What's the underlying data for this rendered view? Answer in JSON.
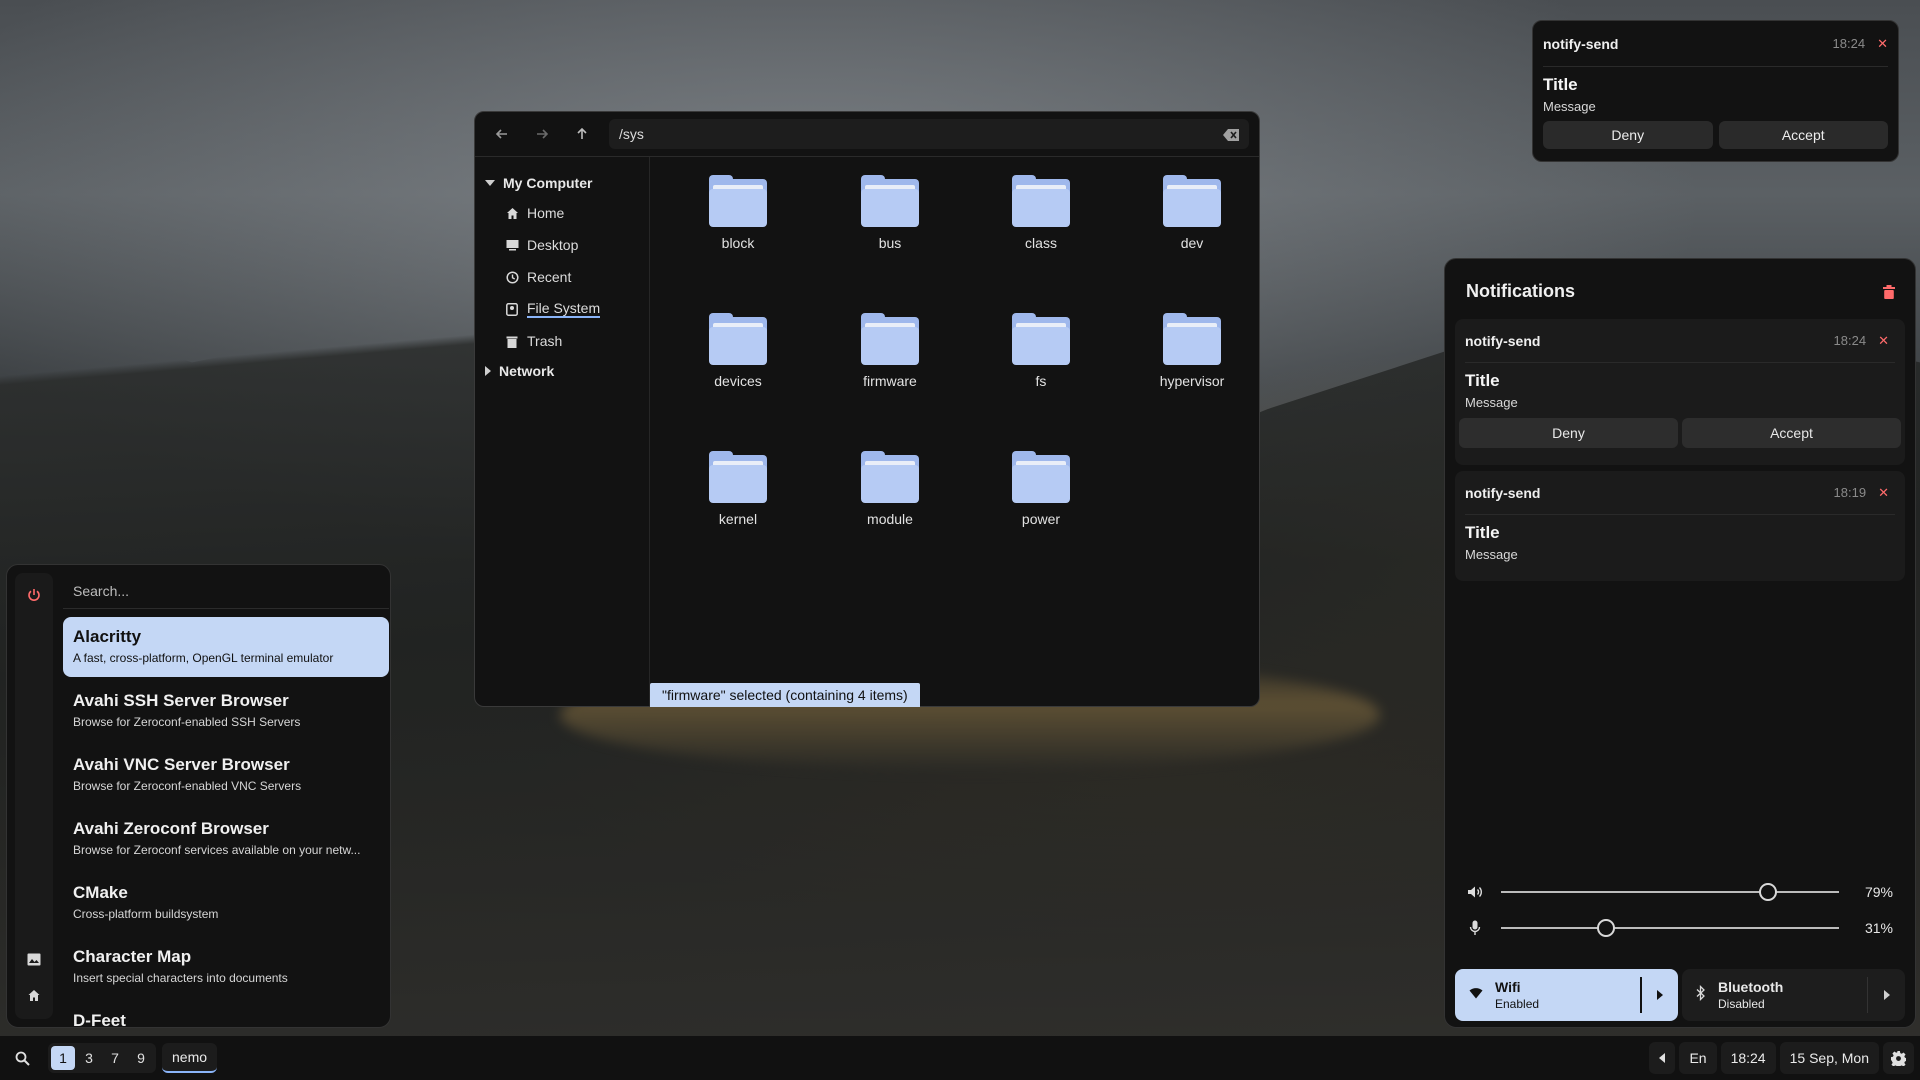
{
  "file_manager": {
    "path": "/sys",
    "sidebar": {
      "my_computer": "My Computer",
      "items": [
        {
          "label": "Home",
          "icon": "home-icon"
        },
        {
          "label": "Desktop",
          "icon": "desktop-icon"
        },
        {
          "label": "Recent",
          "icon": "clock-icon"
        },
        {
          "label": "File System",
          "icon": "drive-icon"
        },
        {
          "label": "Trash",
          "icon": "trash-icon"
        }
      ],
      "network": "Network"
    },
    "folders": [
      "block",
      "bus",
      "class",
      "dev",
      "devices",
      "firmware",
      "fs",
      "hypervisor",
      "kernel",
      "module",
      "power"
    ],
    "status": "\"firmware\" selected (containing 4 items)"
  },
  "popup": {
    "app": "notify-send",
    "time": "18:24",
    "title": "Title",
    "message": "Message",
    "deny": "Deny",
    "accept": "Accept"
  },
  "center": {
    "title": "Notifications",
    "cards": [
      {
        "app": "notify-send",
        "time": "18:24",
        "title": "Title",
        "message": "Message",
        "deny": "Deny",
        "accept": "Accept"
      },
      {
        "app": "notify-send",
        "time": "18:19",
        "title": "Title",
        "message": "Message"
      }
    ],
    "volume": {
      "value": 79,
      "label": "79%"
    },
    "mic": {
      "value": 31,
      "label": "31%"
    },
    "wifi": {
      "name": "Wifi",
      "status": "Enabled"
    },
    "bluetooth": {
      "name": "Bluetooth",
      "status": "Disabled"
    }
  },
  "launcher": {
    "placeholder": "Search...",
    "apps": [
      {
        "name": "Alacritty",
        "desc": "A fast, cross-platform, OpenGL terminal emulator"
      },
      {
        "name": "Avahi SSH Server Browser",
        "desc": "Browse for Zeroconf-enabled SSH Servers"
      },
      {
        "name": "Avahi VNC Server Browser",
        "desc": "Browse for Zeroconf-enabled VNC Servers"
      },
      {
        "name": "Avahi Zeroconf Browser",
        "desc": "Browse for Zeroconf services available on your netw..."
      },
      {
        "name": "CMake",
        "desc": "Cross-platform buildsystem"
      },
      {
        "name": "Character Map",
        "desc": "Insert special characters into documents"
      },
      {
        "name": "D-Feet",
        "desc": ""
      }
    ]
  },
  "taskbar": {
    "workspaces": [
      "1",
      "3",
      "7",
      "9"
    ],
    "active_workspace": "1",
    "task": "nemo",
    "lang": "En",
    "time": "18:24",
    "date": "15 Sep, Mon"
  },
  "colors": {
    "accent": "#c4d7f5",
    "folder": "#9fb8ec",
    "close": "#ff6b6b"
  }
}
